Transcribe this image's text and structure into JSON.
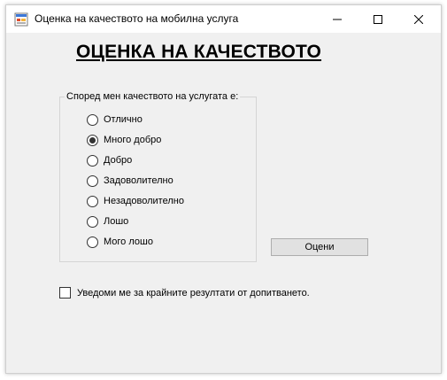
{
  "window": {
    "title": "Оценка на качеството на мобилна услуга",
    "icon": "app-form-icon"
  },
  "heading": "ОЦЕНКА НА КАЧЕСТВОТО",
  "group": {
    "legend": "Според мен качеството на услугата е:",
    "options": [
      {
        "label": "Отлично",
        "checked": false
      },
      {
        "label": "Много добро",
        "checked": true
      },
      {
        "label": "Добро",
        "checked": false
      },
      {
        "label": "Задоволително",
        "checked": false
      },
      {
        "label": "Незадоволително",
        "checked": false
      },
      {
        "label": "Лошо",
        "checked": false
      },
      {
        "label": "Мого лошо",
        "checked": false
      }
    ]
  },
  "rate_button_label": "Оцени",
  "notify_checkbox": {
    "label": "Уведоми ме за крайните резултати от допитването.",
    "checked": false
  }
}
